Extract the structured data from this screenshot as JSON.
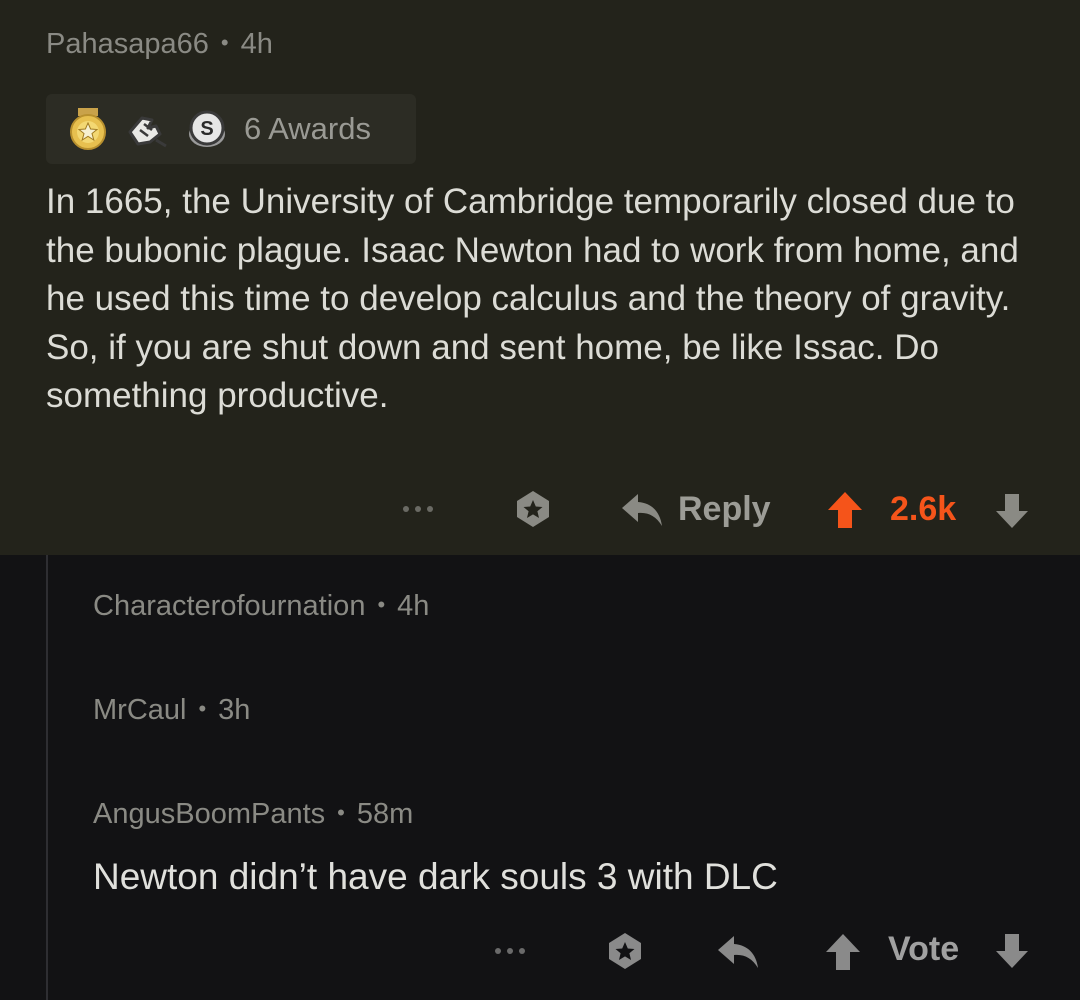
{
  "top_comment": {
    "username": "Pahasapa66",
    "age": "4h",
    "awards": {
      "icons": [
        "medal-star-icon",
        "fist-bump-icon",
        "silver-coin-icon"
      ],
      "label": "6 Awards"
    },
    "body": "In 1665, the University of Cambridge temporarily closed due to the bubonic plague. Isaac Newton had to work from home, and he used this time to develop calculus and the theory of gravity. So, if you are shut down and sent home, be like Issac. Do something productive.",
    "actions": {
      "more_label": "•••",
      "reply_label": "Reply",
      "score": "2.6k"
    },
    "colors": {
      "background": "#23231b",
      "upvote_active": "#f5541a"
    }
  },
  "collapsed_replies": [
    {
      "username": "Characterofournation",
      "age": "4h"
    },
    {
      "username": "MrCaul",
      "age": "3h"
    }
  ],
  "reply": {
    "username": "AngusBoomPants",
    "age": "58m",
    "body": "Newton didn’t have dark souls 3 with DLC",
    "actions": {
      "more_label": "•••",
      "vote_label": "Vote"
    }
  },
  "colors": {
    "page_background": "#121214",
    "meta_text": "#8a8a84"
  }
}
